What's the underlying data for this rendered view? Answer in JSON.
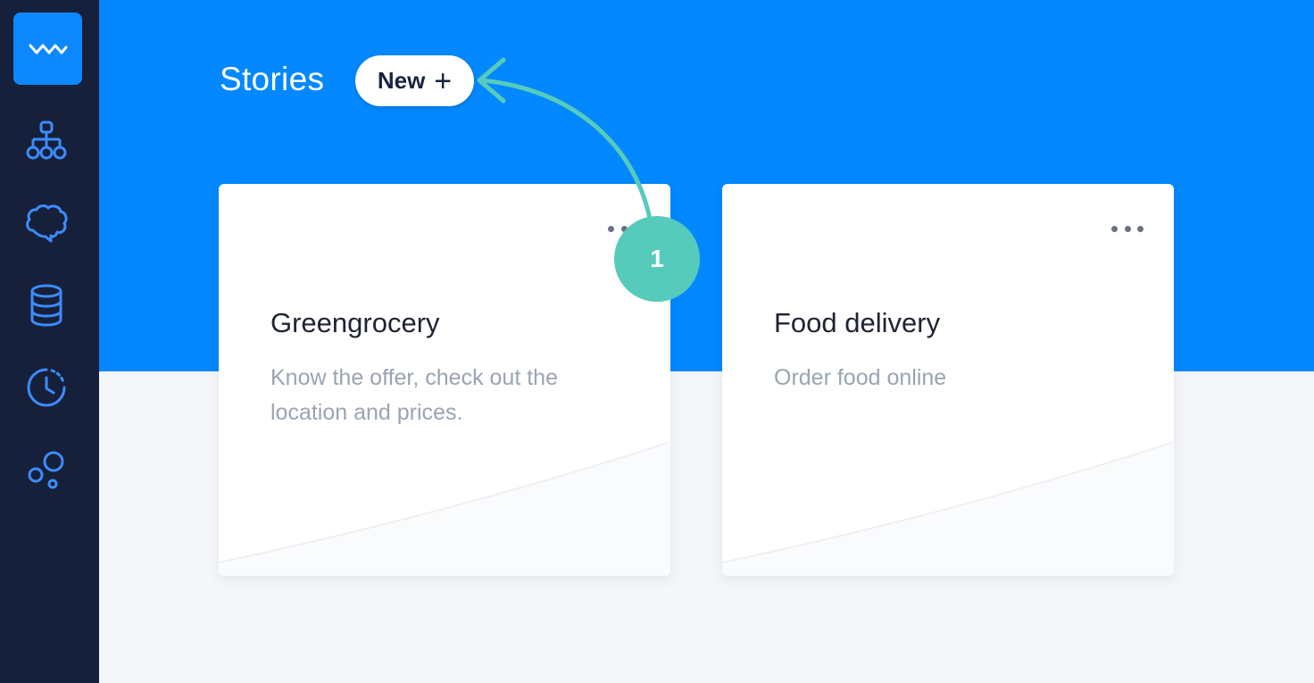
{
  "header": {
    "title": "Stories",
    "new_button_label": "New",
    "new_button_icon": "+"
  },
  "sidebar": {
    "logo": "chatbot-logo-icon",
    "items": [
      {
        "icon": "sitemap-icon"
      },
      {
        "icon": "brain-icon"
      },
      {
        "icon": "database-icon"
      },
      {
        "icon": "history-icon"
      },
      {
        "icon": "bubbles-icon"
      }
    ]
  },
  "stories": [
    {
      "title": "Greengrocery",
      "description": "Know the offer, check out the location and prices."
    },
    {
      "title": "Food delivery",
      "description": "Order food online"
    }
  ],
  "annotation": {
    "step": "1"
  },
  "colors": {
    "sidebar": "#17203a",
    "banner": "#0388ff",
    "accent": "#57cbbb",
    "background": "#f4f6f9"
  }
}
